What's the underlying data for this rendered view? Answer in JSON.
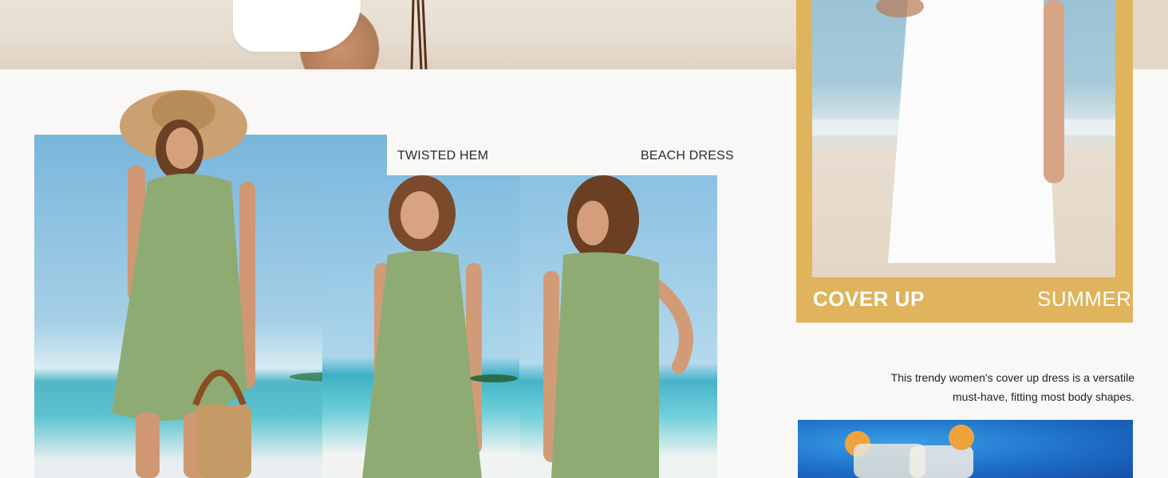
{
  "collage": {
    "label_left": "TWISTED HEM",
    "label_right": "BEACH DRESS"
  },
  "cover_panel": {
    "title": "COVER UP",
    "subtitle": "SUMMER"
  },
  "description": {
    "line1": "This trendy women's cover up dress is a versatile",
    "line2": "must-have, fitting most body shapes."
  },
  "colors": {
    "page_background": "#faf8f6",
    "accent_gold": "#e0b35d",
    "dress_green": "#8fab74",
    "text_dark": "#222222"
  }
}
